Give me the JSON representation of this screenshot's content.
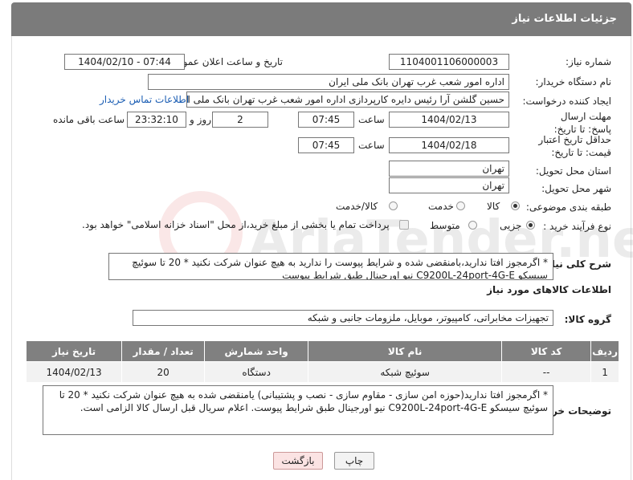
{
  "header": {
    "title": "جزئیات اطلاعات نیاز"
  },
  "labels": {
    "need_number": "شماره نیاز:",
    "announce_datetime": "تاریخ و ساعت اعلان عمومی:",
    "buyer_org": "نام دستگاه خریدار:",
    "requester": "ایجاد کننده درخواست:",
    "reply_deadline": "مهلت ارسال پاسخ: تا تاریخ:",
    "price_validity": "حداقل تاریخ اعتبار قیمت: تا تاریخ:",
    "time_word": "ساعت",
    "day_and": "روز و",
    "remaining": "ساعت باقی مانده",
    "province": "استان محل تحویل:",
    "city": "شهر محل تحویل:",
    "category": "طبقه بندی موضوعی:",
    "purchase_type": "نوع فرآیند خرید :",
    "general_desc": "شرح کلی نیاز:",
    "goods_info": "اطلاعات کالاهای مورد نیاز",
    "goods_group": "گروه کالا:",
    "buyer_notes": "توضیحات خریدار:"
  },
  "values": {
    "need_number": "1104001106000003",
    "announce_datetime": "1404/02/10 - 07:44",
    "buyer_org": "اداره امور شعب غرب تهران بانک ملی ایران",
    "requester": "حسین گلشن آرا رئیس دایره کارپردازی اداره امور شعب غرب تهران بانک ملی ایرا",
    "contact_link": "اطلاعات تماس خریدار",
    "reply_date": "1404/02/13",
    "reply_time": "07:45",
    "reply_days": "2",
    "reply_remaining": "23:32:10",
    "validity_date": "1404/02/18",
    "validity_time": "07:45",
    "province": "تهران",
    "city": "تهران",
    "goods_group": "تجهیزات مخابراتی، کامپیوتر، موبایل، ملزومات جانبی و شبکه"
  },
  "category_options": [
    {
      "label": "کالا",
      "selected": true
    },
    {
      "label": "خدمت",
      "selected": false
    },
    {
      "label": "کالا/خدمت",
      "selected": false
    }
  ],
  "purchase_options": [
    {
      "label": "جزیی",
      "selected": true
    },
    {
      "label": "متوسط",
      "selected": false
    }
  ],
  "payment_note": "پرداخت تمام یا بخشی از مبلغ خرید،از محل \"اسناد خزانه اسلامی\" خواهد بود.",
  "general_desc_text": "* اگرمجوز افتا ندارید،بامنقضی شده و شرایط پیوست را ندارید به هیچ عنوان شرکت نکنید * 20 تا سوئیچ سیسکو C9200L-24port-4G-E نیو اورجینال طبق شرایط پیوست",
  "table": {
    "headers": [
      "ردیف",
      "کد کالا",
      "نام کالا",
      "واحد شمارش",
      "تعداد / مقدار",
      "تاریخ نیاز"
    ],
    "rows": [
      [
        "1",
        "--",
        "سوئیچ شبکه",
        "دستگاه",
        "20",
        "1404/02/13"
      ]
    ]
  },
  "buyer_notes_text": "* اگرمجوز افتا ندارید(حوزه امن سازی - مقاوم سازی - نصب و پشتیبانی) یامنقضی شده به هیچ عنوان شرکت نکنید * 20 تا سوئیچ سیسکو C9200L-24port-4G-E نیو اورجینال طبق شرایط پیوست. اعلام سریال قبل ارسال کالا الزامی است.",
  "buttons": {
    "print": "چاپ",
    "back": "بازگشت"
  },
  "watermark": "AriaTender.net"
}
